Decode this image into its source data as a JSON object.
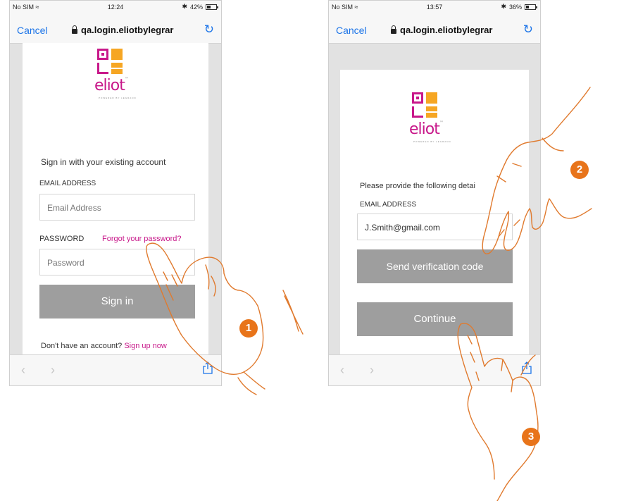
{
  "phones": {
    "left": {
      "status": {
        "carrier": "No SIM",
        "wifi": "≈",
        "time": "12:24",
        "bt": "✱",
        "battery": "42%",
        "battery_level": 0.42
      },
      "url_bar": {
        "cancel": "Cancel",
        "url": "qa.login.eliotbylegrar"
      },
      "logo": {
        "word": "eliot",
        "tm": "™",
        "tagline": "POWERED BY LEGRAND"
      },
      "heading": "Sign in with your existing account",
      "email_label": "EMAIL ADDRESS",
      "email_placeholder": "Email Address",
      "password_label": "PASSWORD",
      "forgot_link": "Forgot your password?",
      "password_placeholder": "Password",
      "sign_in_button": "Sign in",
      "signup_prompt": "Don't have an account?",
      "signup_link": "Sign up now"
    },
    "right": {
      "status": {
        "carrier": "No SIM",
        "wifi": "≈",
        "time": "13:57",
        "bt": "✱",
        "battery": "36%",
        "battery_level": 0.36
      },
      "url_bar": {
        "cancel": "Cancel",
        "url": "qa.login.eliotbylegrar"
      },
      "logo": {
        "word": "eliot",
        "tm": "™",
        "tagline": "POWERED BY LEGRAND"
      },
      "prompt": "Please provide the following detai",
      "email_label": "EMAIL ADDRESS",
      "email_value": "J.Smith@gmail.com",
      "send_code_button": "Send verification code",
      "continue_button": "Continue"
    }
  },
  "steps": [
    "1",
    "2",
    "3"
  ],
  "colors": {
    "brand_magenta": "#c8188a",
    "brand_orange": "#f6a623",
    "badge_orange": "#e8741a",
    "link_blue": "#1a73e8",
    "button_gray": "#9e9e9e"
  },
  "icons": {
    "lock": "lock-icon",
    "reload": "reload-icon",
    "back": "back-arrow-icon",
    "forward": "forward-arrow-icon",
    "share": "share-icon"
  }
}
